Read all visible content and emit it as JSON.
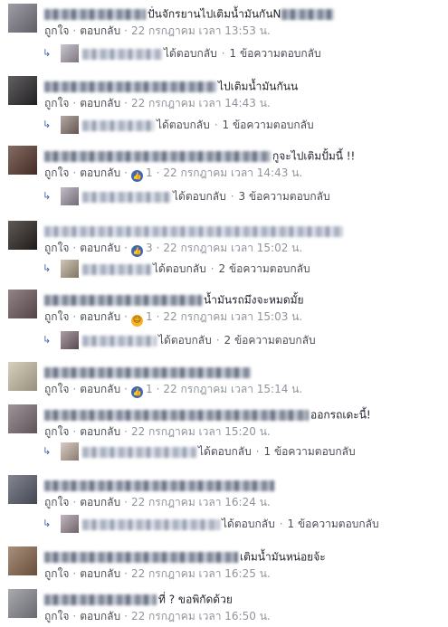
{
  "labels": {
    "like": "ถูกใจ",
    "reply": "ตอบกลับ",
    "replied": "ได้ตอบกลับ",
    "sep": "·"
  },
  "comments": [
    {
      "text": "ปั่นจักรยานไปเติมน้ำมันกันN",
      "text2": "",
      "time": "22 กรกฎาคม เวลา 13:53 น.",
      "reaction": null,
      "reaction_count": "",
      "reply_count": "1 ข้อความตอบกลับ",
      "avatar_color": "#7f7c88",
      "reply_avatar_color": "#b0a9b6"
    },
    {
      "text": "ไปเติมน้ำมันกันน",
      "text2": "",
      "time": "22 กรกฎาคม เวลา 14:43 น.",
      "reaction": null,
      "reaction_count": "",
      "reply_count": "1 ข้อความตอบกลับ",
      "avatar_color": "#2d2a2e",
      "reply_avatar_color": "#8e7b75"
    },
    {
      "text": "กูจะไปเติมปั้มนี้ !!",
      "text2": "",
      "time": "22 กรกฎาคม เวลา 14:43 น.",
      "reaction": "like",
      "reaction_count": "1",
      "reply_count": "3 ข้อความตอบกลับ",
      "avatar_color": "#5a3a30",
      "reply_avatar_color": "#a29aa8"
    },
    {
      "text": "",
      "text2": "",
      "time": "22 กรกฎาคม เวลา 15:02 น.",
      "reaction": "like",
      "reaction_count": "3",
      "reply_count": "2 ข้อความตอบกลับ",
      "avatar_color": "#2b2320",
      "reply_avatar_color": "#b8a88f"
    },
    {
      "text": "น้ำมันรถมึงจะหมดมั้ย",
      "text2": "",
      "time": "22 กรกฎาคม เวลา 15:03 น.",
      "reaction": "haha",
      "reaction_count": "1",
      "reply_count": "2 ข้อความตอบกลับ",
      "avatar_color": "#6e5a5e",
      "reply_avatar_color": "#7e6a73"
    },
    {
      "text": "",
      "text2": "",
      "time": "22 กรกฎาคม เวลา 15:14 น.",
      "reaction": "like",
      "reaction_count": "1",
      "reply_count": "",
      "avatar_color": "#c9c0a6",
      "reply_avatar_color": ""
    },
    {
      "text": "ออกรถเดะนี้!",
      "text2": "",
      "time": "22 กรกฎาคม เวลา 15:20 น.",
      "reaction": null,
      "reaction_count": "",
      "reply_count": "1 ข้อความตอบกลับ",
      "avatar_color": "#7d7077",
      "reply_avatar_color": "#c6b0a4"
    },
    {
      "text": "",
      "text2": "",
      "time": "22 กรกฎาคม เวลา 16:24 น.",
      "reaction": null,
      "reaction_count": "",
      "reply_count": "1 ข้อความตอบกลับ",
      "avatar_color": "#5a5f6d",
      "reply_avatar_color": "#a08f9a"
    },
    {
      "text": "เติมน้ำมันหน่อยจ้ะ",
      "text2": "",
      "time": "22 กรกฎาคม เวลา 16:25 น.",
      "reaction": null,
      "reaction_count": "",
      "reply_count": "",
      "avatar_color": "#8a6a4f",
      "reply_avatar_color": ""
    },
    {
      "text": "ที่ ? ขอพิกัดด้วย",
      "text2": "",
      "time": "22 กรกฎาคม เวลา 16:50 น.",
      "reaction": null,
      "reaction_count": "",
      "reply_count": "",
      "avatar_color": "#8b8e94",
      "reply_avatar_color": ""
    }
  ]
}
